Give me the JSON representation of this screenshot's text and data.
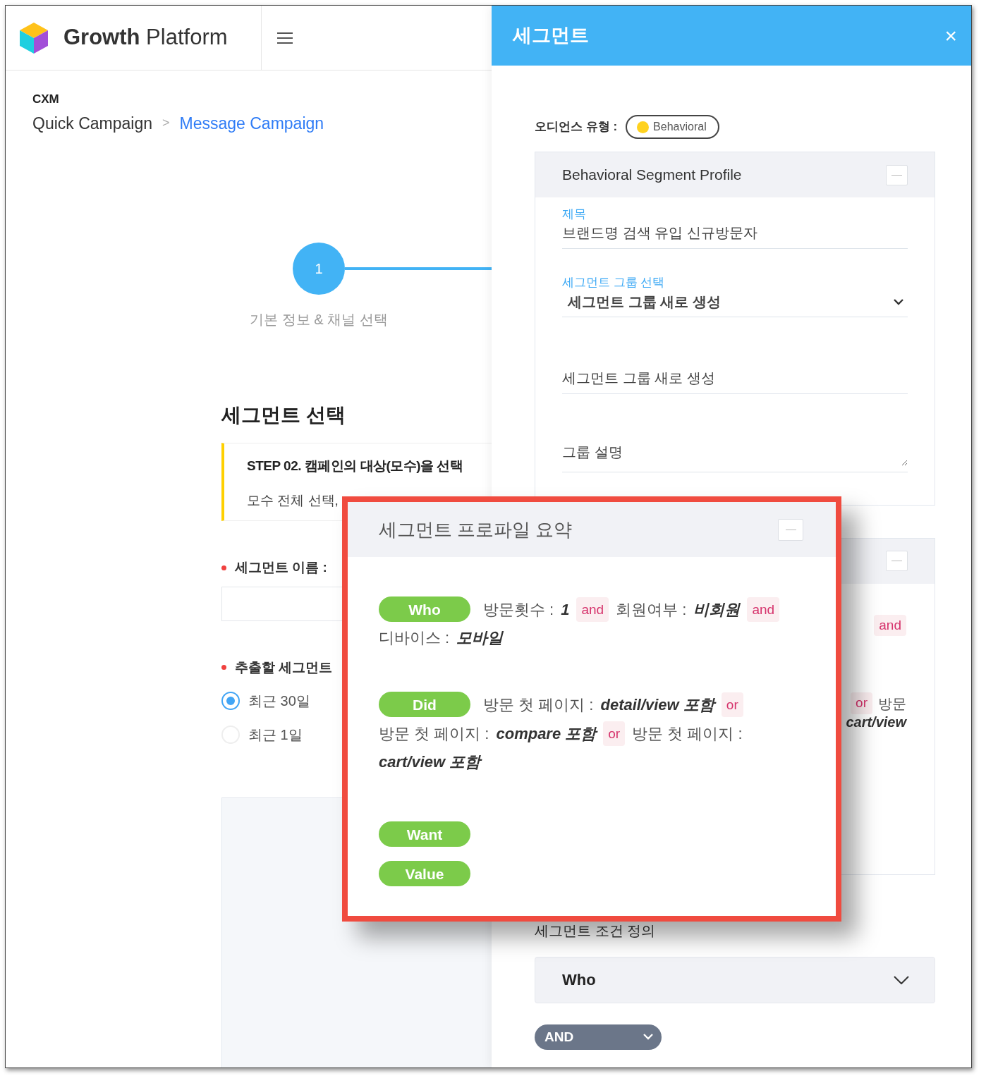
{
  "header": {
    "logo_bold": "Growth",
    "logo_text": "Platform"
  },
  "breadcrumb": {
    "section": "CXM",
    "separator": ">",
    "items": [
      {
        "label": "Quick Campaign",
        "selected": false
      },
      {
        "label": "Message Campaign",
        "selected": true
      }
    ]
  },
  "stepper": [
    {
      "number": "1",
      "label": "기본 정보 & 채널 선택",
      "active": true
    }
  ],
  "segment_select": {
    "title": "세그먼트 선택",
    "step_title": "STEP 02. 캠페인의 대상(모수)을 선택",
    "step_text": "모수 전체 선택,",
    "name_label": "세그먼트 이름 :",
    "period_label": "추출할 세그먼트",
    "periods": [
      {
        "label": "최근 30일",
        "selected": true
      },
      {
        "label": "최근 1일",
        "selected": false
      }
    ]
  },
  "drawer": {
    "title": "세그먼트",
    "close": "×",
    "audience_label": "오디언스 유형 :",
    "audience_type": {
      "label": "Behavioral",
      "color": "#ffd21f"
    },
    "profile": {
      "title": "Behavioral Segment Profile",
      "fields": [
        {
          "kind": "text",
          "label": "제목",
          "value": "브랜드명 검색 유입 신규방문자"
        },
        {
          "kind": "select",
          "label": "세그먼트 그룹 선택",
          "value": "세그먼트 그룹 새로 생성"
        },
        {
          "kind": "text",
          "value": "세그먼트 그룹 새로 생성"
        },
        {
          "kind": "textarea",
          "placeholder": "그룹 설명"
        }
      ]
    },
    "summary_behind": [
      {
        "kind": "op",
        "text": "and"
      },
      {
        "kind": "op",
        "text": "or"
      },
      {
        "kind": "text",
        "text": "방문"
      },
      {
        "kind": "value",
        "text": "cart/view"
      }
    ],
    "condition": {
      "label": "세그먼트 조건 정의",
      "select": "Who",
      "operator": "AND"
    }
  },
  "summary_popup": {
    "title": "세그먼트 프로파일 요약",
    "rows": [
      {
        "tag": "Who",
        "parts": [
          {
            "kind": "text",
            "text": "방문횟수 :"
          },
          {
            "kind": "value",
            "text": "1"
          },
          {
            "kind": "op",
            "text": "and"
          },
          {
            "kind": "text",
            "text": "회원여부 :"
          },
          {
            "kind": "value",
            "text": "비회원"
          },
          {
            "kind": "op",
            "text": "and"
          },
          {
            "kind": "text",
            "text": "디바이스 :"
          },
          {
            "kind": "value",
            "text": "모바일"
          }
        ]
      },
      {
        "tag": "Did",
        "parts": [
          {
            "kind": "text",
            "text": "방문 첫 페이지 :"
          },
          {
            "kind": "value",
            "text": "detail/view 포함"
          },
          {
            "kind": "op",
            "text": "or"
          },
          {
            "kind": "text",
            "text": "방문 첫 페이지 :"
          },
          {
            "kind": "value",
            "text": "compare 포함"
          },
          {
            "kind": "op",
            "text": "or"
          },
          {
            "kind": "text",
            "text": "방문 첫 페이지 :"
          },
          {
            "kind": "value",
            "text": "cart/view 포함"
          }
        ]
      },
      {
        "tag": "Want",
        "parts": []
      },
      {
        "tag": "Value",
        "parts": []
      }
    ]
  }
}
